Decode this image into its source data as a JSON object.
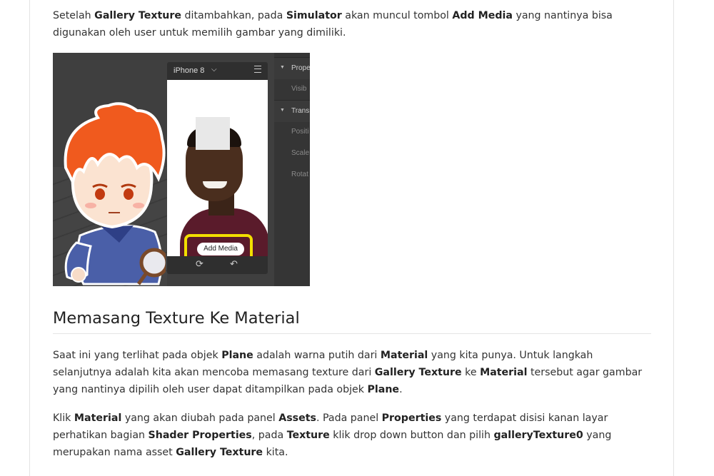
{
  "intro": {
    "t1": "Setelah ",
    "b1": "Gallery Texture",
    "t2": " ditambahkan, pada ",
    "b2": "Simulator",
    "t3": " akan muncul tombol ",
    "b3": "Add Media",
    "t4": " yang nantinya bisa digunakan oleh user untuk memilih gambar yang dimiliki."
  },
  "screenshot": {
    "device_label": "iPhone 8",
    "add_media_label": "Add Media",
    "panel_rows": [
      {
        "label": "Prope"
      },
      {
        "label": "Visib"
      },
      {
        "label": "Trans"
      },
      {
        "label": "Positi"
      },
      {
        "label": "Scale"
      },
      {
        "label": "Rotat"
      }
    ],
    "highlight_color": "#f2df00"
  },
  "section": {
    "heading": "Memasang Texture Ke Material"
  },
  "para2": {
    "t1": "Saat ini yang terlihat pada objek ",
    "b1": "Plane",
    "t2": " adalah warna putih dari ",
    "b2": "Material",
    "t3": " yang kita punya. Untuk langkah selanjutnya adalah kita akan mencoba memasang texture dari ",
    "b3": "Gallery Texture",
    "t4": " ke ",
    "b4": "Material",
    "t5": " tersebut agar gambar yang nantinya dipilih oleh user dapat ditampilkan pada objek ",
    "b5": "Plane",
    "t6": "."
  },
  "para3": {
    "t1": "Klik ",
    "b1": "Material",
    "t2": " yang akan diubah pada panel ",
    "b2": "Assets",
    "t3": ". Pada panel ",
    "b3": "Properties",
    "t4": " yang terdapat disisi kanan layar perhatikan bagian ",
    "b4": "Shader Properties",
    "t5": ", pada ",
    "b5": "Texture",
    "t6": " klik drop down button dan pilih ",
    "b6": "galleryTexture0",
    "t7": " yang merupakan nama asset ",
    "b7": "Gallery Texture",
    "t8": " kita."
  }
}
